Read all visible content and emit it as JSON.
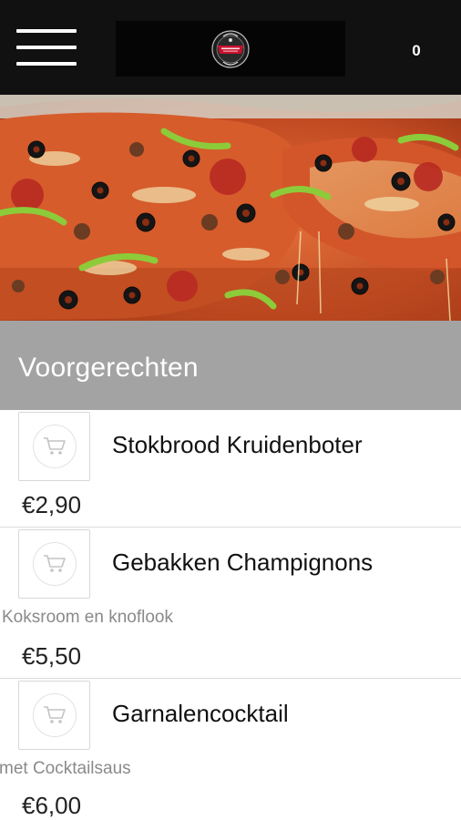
{
  "header": {
    "menu_icon": "hamburger-menu-icon",
    "logo_icon": "pizzeria-logo-badge",
    "cart_count": "0"
  },
  "section": {
    "title": "Voorgerechten"
  },
  "products": [
    {
      "name": "Stokbrood Kruidenboter",
      "description": "",
      "price": "€2,90",
      "icon": "shopping-cart-icon"
    },
    {
      "name": "Gebakken Champignons",
      "description": "Koksroom en knoflook",
      "price": "€5,50",
      "icon": "shopping-cart-icon"
    },
    {
      "name": "Garnalencocktail",
      "description": "met Cocktailsaus",
      "price": "€6,00",
      "icon": "shopping-cart-icon"
    }
  ],
  "colors": {
    "header_bg": "#111111",
    "section_bg": "#a3a3a3",
    "logo_red": "#c8102e"
  }
}
